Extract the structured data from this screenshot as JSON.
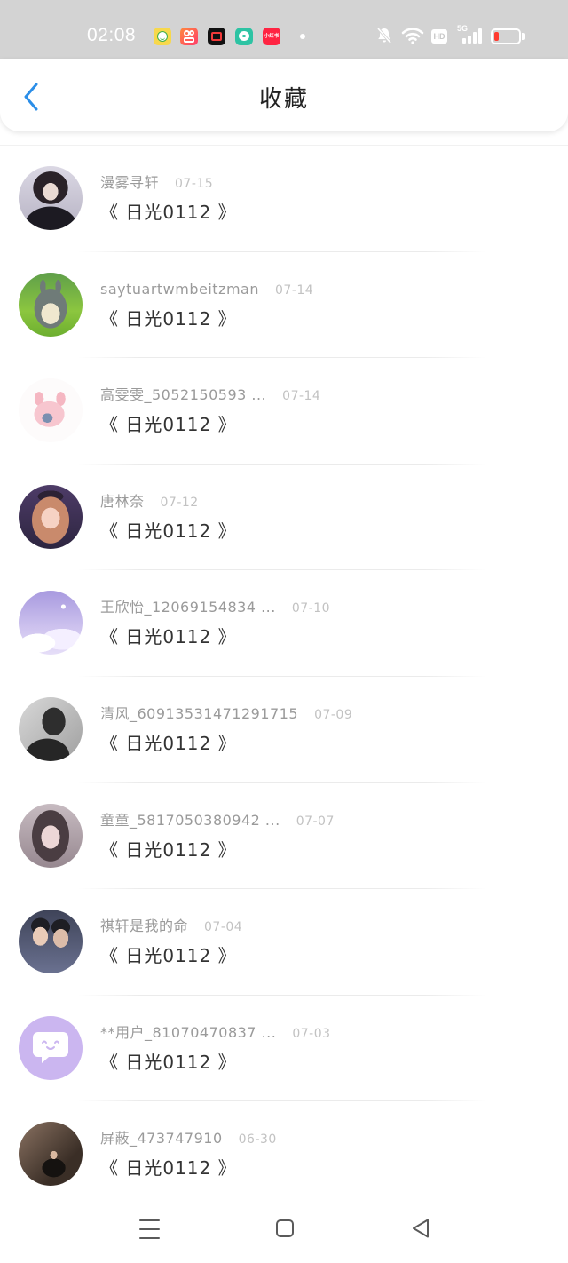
{
  "status_bar": {
    "time": "02:08",
    "notification_apps": [
      {
        "icon": "smiley-app-icon",
        "color": "#f7d84c"
      },
      {
        "icon": "kuaishou-app-icon",
        "color": "#ff5a4f"
      },
      {
        "icon": "video-app-icon",
        "color": "#111111"
      },
      {
        "icon": "chat-bubble-app-icon",
        "color": "#2dc3a3"
      },
      {
        "icon": "xiaohongshu-app-icon",
        "color": "#ff2442",
        "label": "小红书"
      }
    ],
    "icons": [
      "more-notifications-dot-icon",
      "mute-bell-icon",
      "wifi-icon",
      "hd-icon",
      "cellular-signal-icon",
      "battery-icon"
    ],
    "hd_label": "HD",
    "network_label": "5G",
    "battery_level": 0.2,
    "battery_color": "#ff3b30"
  },
  "header": {
    "back_icon": "chevron-left-icon",
    "title": "收藏",
    "accent_color": "#2b8ee8"
  },
  "favorites": [
    {
      "name": "漫雾寻轩",
      "date": "07-15",
      "title": "《 日光0112 》"
    },
    {
      "name": "saytuartwmbeitzman",
      "date": "07-14",
      "title": "《 日光0112 》"
    },
    {
      "name": "高雯雯_5052150593 ...",
      "date": "07-14",
      "title": "《 日光0112 》"
    },
    {
      "name": "唐林奈",
      "date": "07-12",
      "title": "《 日光0112 》"
    },
    {
      "name": "王欣怡_12069154834 ...",
      "date": "07-10",
      "title": "《 日光0112 》"
    },
    {
      "name": "清风_60913531471291715",
      "date": "07-09",
      "title": "《 日光0112 》"
    },
    {
      "name": "童童_5817050380942 ...",
      "date": "07-07",
      "title": "《 日光0112 》"
    },
    {
      "name": "祺轩是我的命",
      "date": "07-04",
      "title": "《 日光0112 》"
    },
    {
      "name": "**用户_81070470837 ...",
      "date": "07-03",
      "title": "《 日光0112 》"
    },
    {
      "name": "屏蔽_473747910",
      "date": "06-30",
      "title": "《 日光0112 》"
    }
  ],
  "nav_bar": {
    "icons": [
      "menu-icon",
      "home-square-icon",
      "back-triangle-icon"
    ]
  }
}
